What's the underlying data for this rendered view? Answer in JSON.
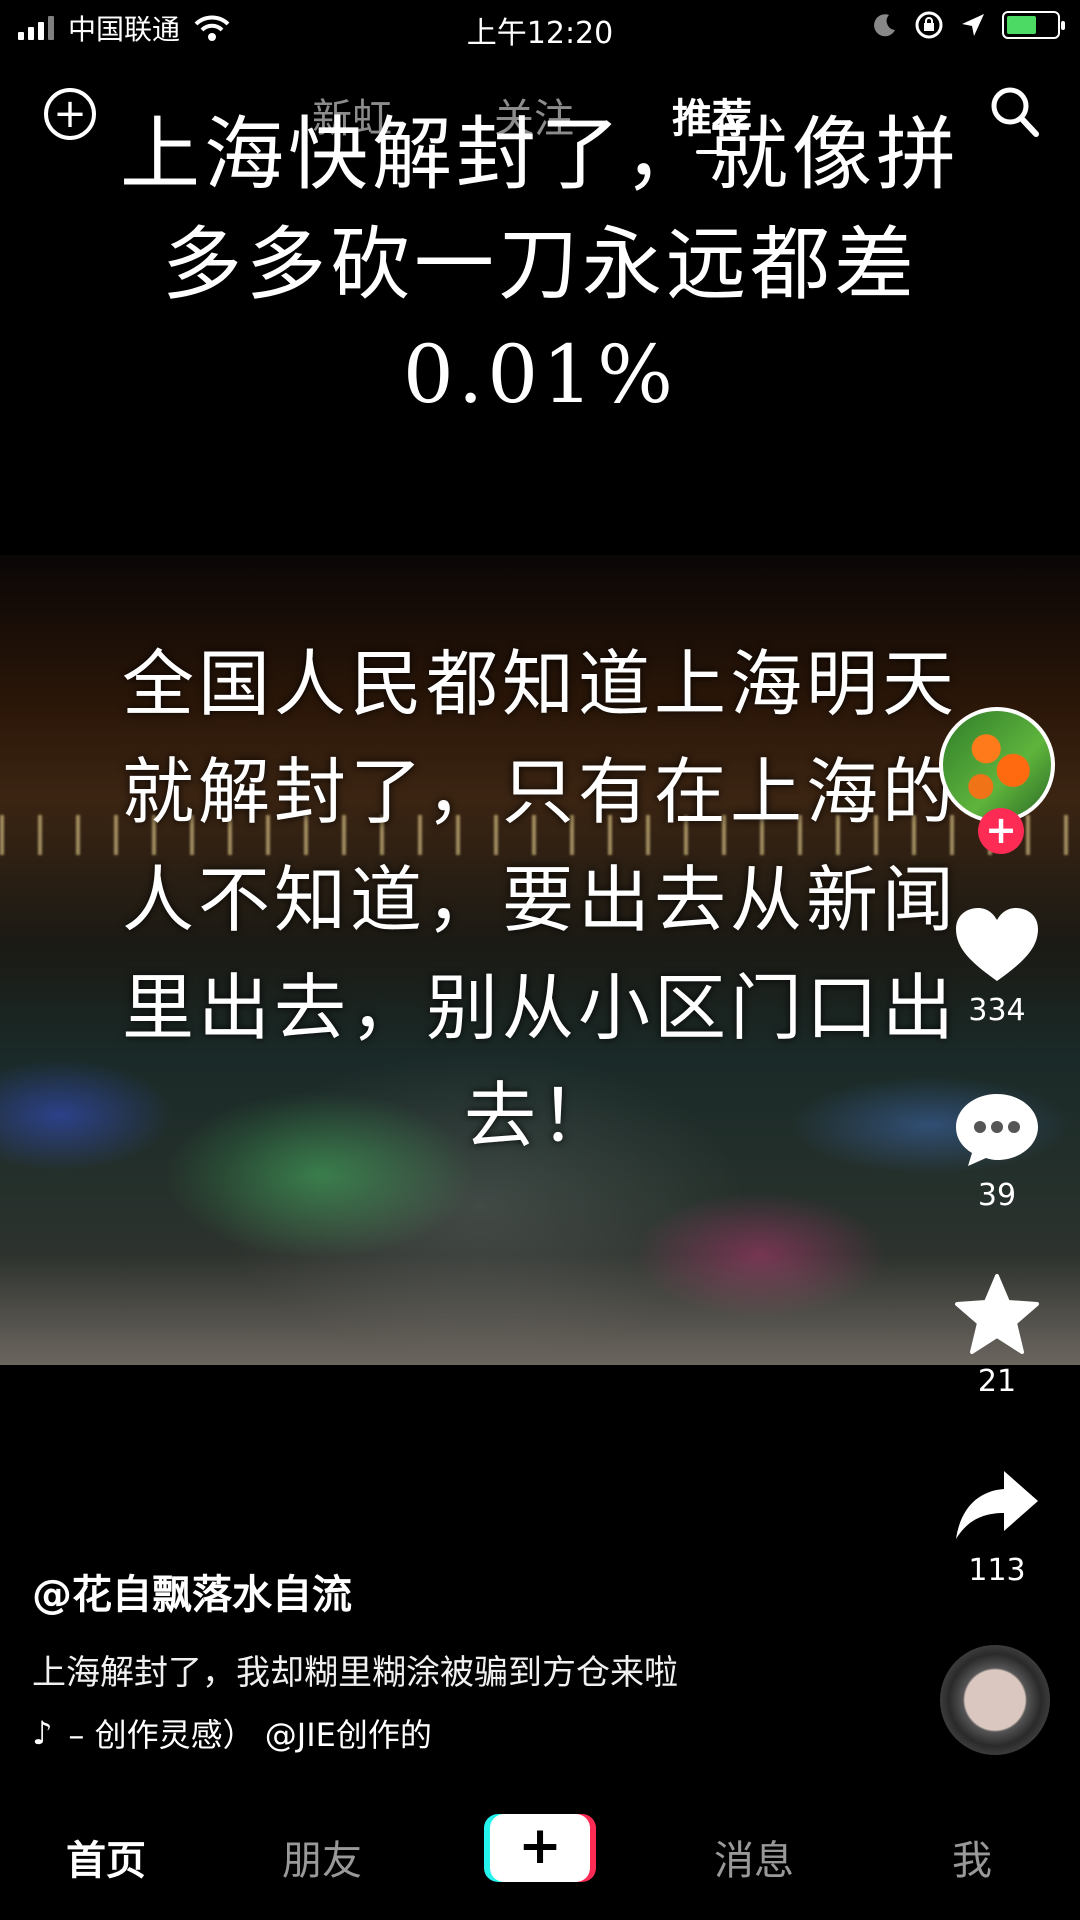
{
  "status_bar": {
    "carrier": "中国联通",
    "time": "上午12:20"
  },
  "top_nav": {
    "tabs": [
      {
        "label": "新虹",
        "active": false
      },
      {
        "label": "关注",
        "active": false
      },
      {
        "label": "推荐",
        "active": true
      }
    ]
  },
  "video": {
    "caption_top": "上海快解封了，就像拼多多砍一刀永远都差0.01%",
    "caption_bottom": "全国人民都知道上海明天就解封了，只有在上海的人不知道，要出去从新闻里出去，别从小区门口出去！"
  },
  "rail": {
    "likes": "334",
    "comments": "39",
    "favorites": "21",
    "shares": "113"
  },
  "post": {
    "author": "@花自飘落水自流",
    "description": "上海解封了，我却糊里糊涂被骗到方仓来啦",
    "music": "– 创作灵感）    @JIE创作的"
  },
  "bottom_bar": {
    "home": "首页",
    "friends": "朋友",
    "create": "+",
    "messages": "消息",
    "me": "我"
  },
  "colors": {
    "accent_red": "#fe2c55",
    "accent_cyan": "#25f4ee",
    "battery_green": "#4cd964"
  },
  "battery_level": 0.6
}
